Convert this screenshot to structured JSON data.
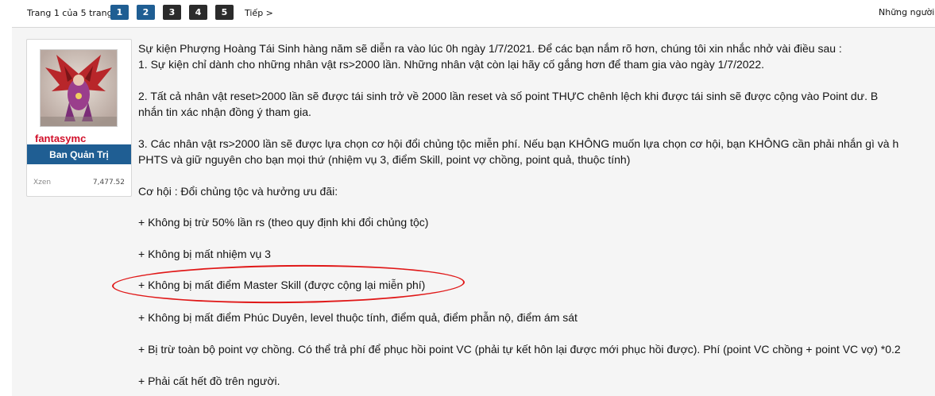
{
  "pagination": {
    "label": "Trang 1 của 5 trang",
    "pages": [
      "1",
      "2",
      "3",
      "4",
      "5"
    ],
    "next": "Tiếp >",
    "viewers": "Những người đ"
  },
  "user": {
    "name": "fantasymc",
    "role": "Ban Quản Trị",
    "stat_label": "Xzen",
    "stat_value": "7,477.52"
  },
  "post": {
    "lines": [
      "Sự kiện Phượng Hoàng Tái Sinh hàng năm sẽ diễn ra vào lúc 0h ngày 1/7/2021. Để các bạn nắm rõ hơn, chúng tôi xin nhắc nhở vài điều sau :",
      "1. Sự kiện chỉ dành cho những nhân vật rs>2000 lần. Những nhân vật còn lại hãy cố gắng hơn để tham gia vào ngày 1/7/2022.",
      "2. Tất cả nhân vật reset>2000 lần sẽ được tái sinh trở về 2000 lần reset và số point THỰC chênh lệch khi được tái sinh sẽ được cộng vào Point dư. B",
      "nhắn tin xác nhận đồng ý tham gia.",
      "3. Các nhân vật rs>2000 lần sẽ được lựa chọn cơ hội đổi chủng tộc miễn phí. Nếu bạn KHÔNG muốn lựa chọn cơ hội, bạn KHÔNG cần phải nhắn gì và h",
      "PHTS và giữ nguyên cho bạn mọi thứ (nhiệm vụ 3, điểm Skill, point vợ chồng, point quả, thuộc tính)",
      "Cơ hội : Đổi chủng tộc và hưởng ưu đãi:",
      "+ Không bị trừ 50% lần rs (theo quy định khi đổi chủng tộc)",
      "+ Không bị mất nhiệm vụ 3",
      "+ Không bị mất điểm Master Skill (được cộng lại miễn phí)",
      "+ Không bị mất điểm Phúc Duyên, level thuộc tính, điểm quả, điểm phẫn nộ, điểm ám sát",
      "+ Bị trừ toàn bộ point vợ chồng. Có thể trả phí để phục hồi point VC (phải tự kết hôn lại được mới phục hồi được). Phí (point VC chồng + point VC vợ) *0.2",
      "+ Phải cất hết đồ trên người."
    ]
  },
  "colors": {
    "page_btn_active": "#1f5e93",
    "page_btn": "#2b2b2b",
    "username": "#d1102a",
    "role_badge": "#1f5e93",
    "annotation_circle": "#e01818"
  }
}
